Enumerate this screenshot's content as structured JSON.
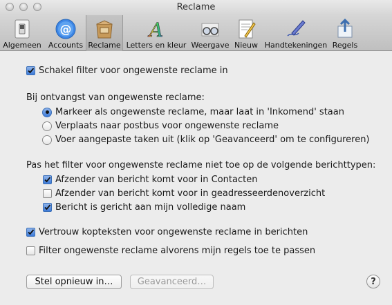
{
  "window": {
    "title": "Reclame"
  },
  "toolbar": {
    "items": [
      {
        "label": "Algemeen",
        "icon": "light-switch-icon"
      },
      {
        "label": "Accounts",
        "icon": "at-sign-icon"
      },
      {
        "label": "Reclame",
        "icon": "junk-mail-bag-icon",
        "selected": true
      },
      {
        "label": "Letters en kleur",
        "icon": "fonts-colors-icon"
      },
      {
        "label": "Weergave",
        "icon": "glasses-icon"
      },
      {
        "label": "Nieuw",
        "icon": "compose-icon"
      },
      {
        "label": "Handtekeningen",
        "icon": "pen-icon"
      },
      {
        "label": "Regels",
        "icon": "rules-icon"
      }
    ]
  },
  "filter_enable": {
    "label": "Schakel filter voor ongewenste reclame in",
    "checked": true
  },
  "on_receive": {
    "heading": "Bij ontvangst van ongewenste reclame:",
    "options": [
      {
        "label": "Markeer als ongewenste reclame, maar laat in 'Inkomend' staan",
        "selected": true
      },
      {
        "label": "Verplaats naar postbus voor ongewenste reclame",
        "selected": false
      },
      {
        "label": "Voer aangepaste taken uit (klik op 'Geavanceerd' om te configureren)",
        "selected": false
      }
    ]
  },
  "exempt": {
    "heading": "Pas het filter voor ongewenste reclame niet toe op de volgende berichttypen:",
    "options": [
      {
        "label": "Afzender van bericht komt voor in Contacten",
        "checked": true
      },
      {
        "label": "Afzender van bericht komt voor in geadresseerdenoverzicht",
        "checked": false
      },
      {
        "label": "Bericht is gericht aan mijn volledige naam",
        "checked": true
      }
    ]
  },
  "trust_headers": {
    "label": "Vertrouw kopteksten voor ongewenste reclame in berichten",
    "checked": true
  },
  "filter_before_rules": {
    "label": "Filter ongewenste reclame alvorens mijn regels toe te passen",
    "checked": false
  },
  "buttons": {
    "reset": "Stel opnieuw in…",
    "advanced": "Geavanceerd…",
    "help": "?"
  },
  "colors": {
    "accent": "#3d7bd9",
    "window_bg": "#ececec"
  }
}
